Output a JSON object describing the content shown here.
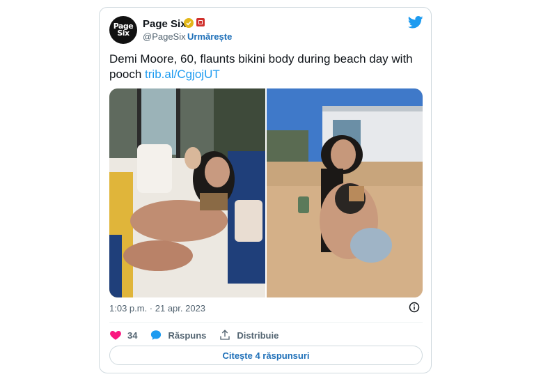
{
  "account": {
    "name": "Page Six",
    "avatar_text_1": "Page",
    "avatar_text_2": "Six",
    "handle": "@PageSix",
    "separator": "·",
    "follow_label": "Urmărește"
  },
  "tweet": {
    "text": "Demi Moore, 60, flaunts bikini body during beach day with pooch ",
    "link": "trib.al/CgjojUT",
    "timestamp": "1:03 p.m. · 21 apr. 2023"
  },
  "actions": {
    "likes_count": "34",
    "reply_label": "Răspuns",
    "share_label": "Distribuie",
    "read_replies_label": "Citește 4 răspunsuri"
  },
  "colors": {
    "accent": "#1d9bf0",
    "link_dark": "#1d6fb8",
    "like": "#f91880",
    "verified": "#e2b719"
  }
}
